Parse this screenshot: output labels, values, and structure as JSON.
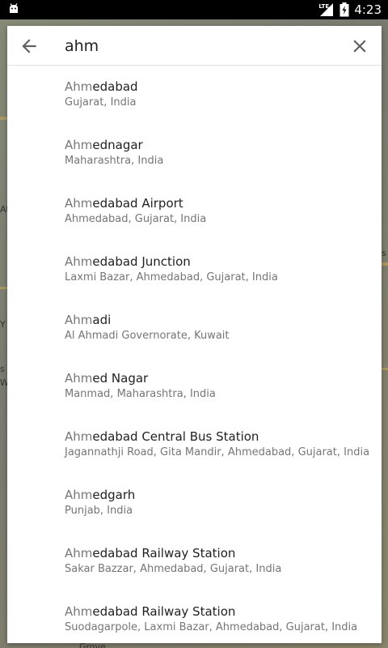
{
  "status_bar": {
    "time": "4:23",
    "network": "LTE",
    "app_icon": "android-debug-icon",
    "icons": [
      "lte-icon",
      "signal-icon",
      "battery-icon"
    ]
  },
  "search": {
    "query": "ahm",
    "back_icon": "arrow-back-icon",
    "clear_icon": "close-icon"
  },
  "results": [
    {
      "match": "Ahm",
      "rest": "edabad",
      "subtitle": "Gujarat, India"
    },
    {
      "match": "Ahm",
      "rest": "ednagar",
      "subtitle": "Maharashtra, India"
    },
    {
      "match": "Ahm",
      "rest": "edabad Airport",
      "subtitle": "Ahmedabad, Gujarat, India"
    },
    {
      "match": "Ahm",
      "rest": "edabad Junction",
      "subtitle": "Laxmi Bazar, Ahmedabad, Gujarat, India"
    },
    {
      "match": "Ahm",
      "rest": "adi",
      "subtitle": "Al Ahmadi Governorate, Kuwait"
    },
    {
      "match": "Ahm",
      "rest": "ed Nagar",
      "subtitle": "Manmad, Maharashtra, India"
    },
    {
      "match": "Ahm",
      "rest": "edabad Central Bus Station",
      "subtitle": "Jagannathji Road, Gita Mandir, Ahmedabad, Gujarat, India"
    },
    {
      "match": "Ahm",
      "rest": "edgarh",
      "subtitle": "Punjab, India"
    },
    {
      "match": "Ahm",
      "rest": "edabad Railway Station",
      "subtitle": "Sakar Bazzar, Ahmedabad, Gujarat, India"
    },
    {
      "match": "Ahm",
      "rest": "edabad Railway Station",
      "subtitle": "Suodagarpole, Laxmi Bazar, Ahmedabad, Gujarat, India"
    }
  ],
  "map_fragments": {
    "left_1": "At",
    "left_2": "s",
    "left_3": "Y",
    "left_4": "W",
    "right_1": "s",
    "bottom": "Grove"
  },
  "colors": {
    "status_bar": "#000000",
    "card": "#ffffff",
    "match_text": "#777777",
    "title_text": "#212121",
    "subtitle_text": "#757575"
  }
}
